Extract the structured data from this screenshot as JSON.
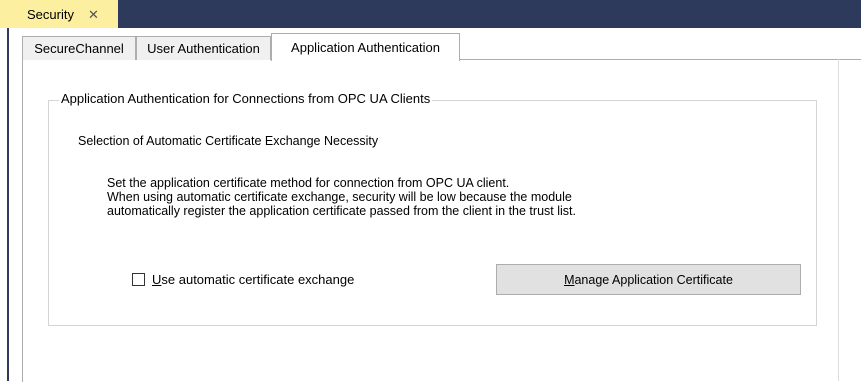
{
  "document_tab": {
    "title": "Security",
    "close_glyph": "✕"
  },
  "tabs": [
    {
      "label": "SecureChannel",
      "active": false
    },
    {
      "label": "User Authentication",
      "active": false
    },
    {
      "label": "Application Authentication",
      "active": true
    }
  ],
  "group": {
    "caption": "Application Authentication for Connections from OPC UA Clients",
    "selection_label": "Selection of Automatic Certificate Exchange Necessity",
    "description": [
      "Set the application certificate method for connection from OPC UA client.",
      "When using automatic certificate exchange, security will be low because the module",
      "automatically register the application certificate passed from the client in the trust list."
    ],
    "checkbox": {
      "mnemonic": "U",
      "label_rest": "se automatic certificate exchange",
      "checked": false
    },
    "button": {
      "mnemonic": "M",
      "label_rest": "anage Application Certificate"
    }
  },
  "colors": {
    "title_strip": "#2d3a5c",
    "doc_tab": "#fcefa0",
    "button_face": "#e1e1e1",
    "inactive_tab": "#f0f0f0"
  }
}
